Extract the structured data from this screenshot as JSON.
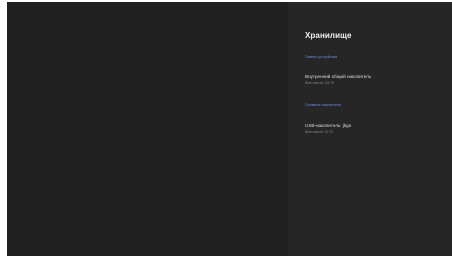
{
  "storage": {
    "title": "Хранилище",
    "device_memory_header": "Память устройства",
    "internal": {
      "name": "Внутренний общий накопитель",
      "detail": "Всего места: 3,6 ГБ"
    },
    "removable_header": "Съемные накопители",
    "usb": {
      "name": "USB-накопитель: jkgo",
      "detail": "Всего места: 31 ГБ"
    }
  }
}
